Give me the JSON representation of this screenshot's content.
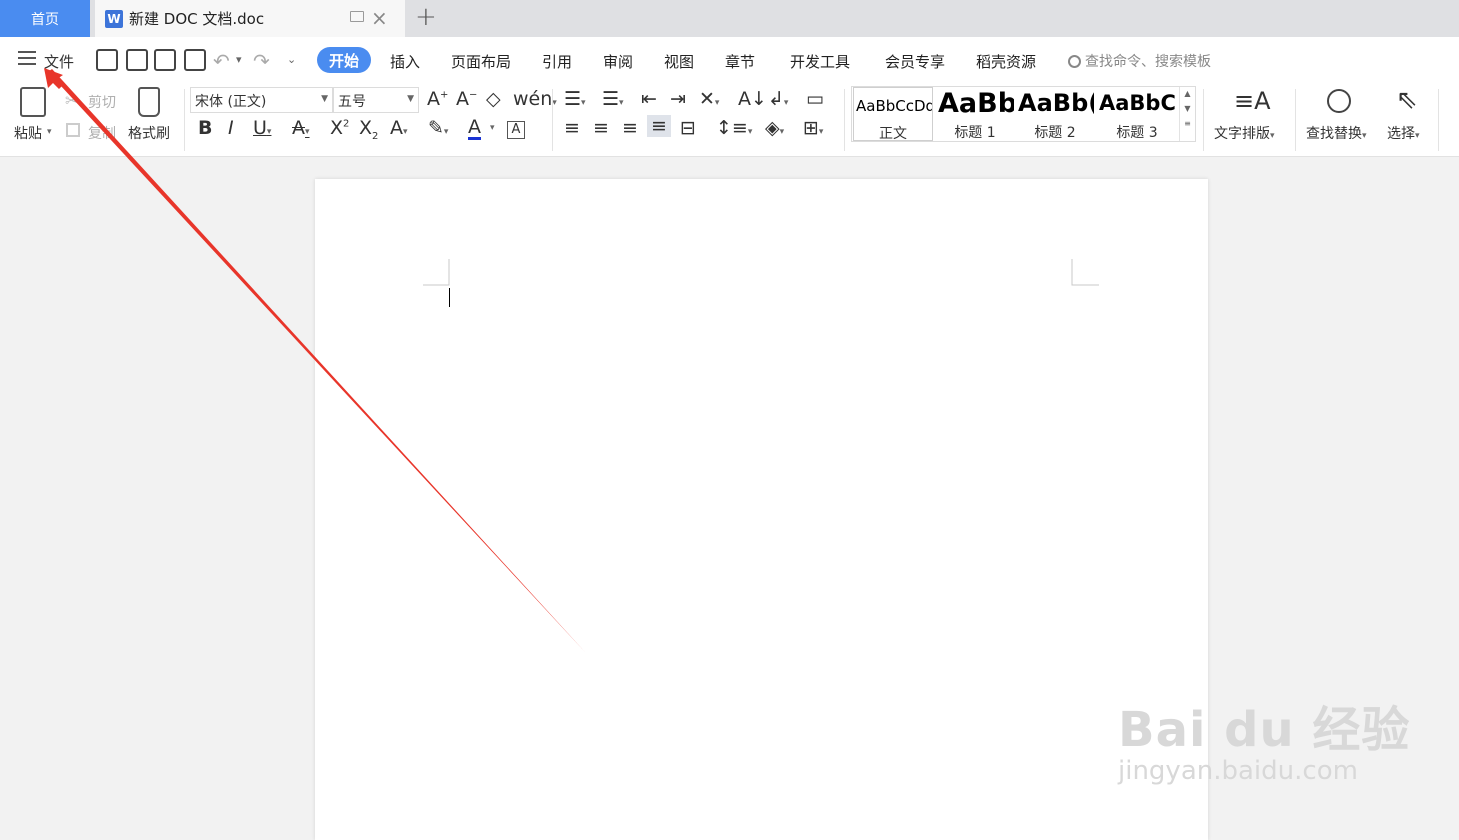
{
  "tabs": {
    "home": "首页",
    "document": "新建 DOC 文档.doc"
  },
  "menu": {
    "file": "文件",
    "tabs": [
      "开始",
      "插入",
      "页面布局",
      "引用",
      "审阅",
      "视图",
      "章节",
      "开发工具",
      "会员专享",
      "稻壳资源"
    ],
    "active_tab": "开始",
    "search_placeholder": "查找命令、搜索模板"
  },
  "ribbon": {
    "paste": "粘贴",
    "cut": "剪切",
    "copy": "复制",
    "format_painter": "格式刷",
    "font_name": "宋体 (正文)",
    "font_size": "五号",
    "styles": [
      {
        "preview": "AaBbCcDd",
        "name": "正文"
      },
      {
        "preview": "AaBb",
        "name": "标题 1"
      },
      {
        "preview": "AaBb(",
        "name": "标题 2"
      },
      {
        "preview": "AaBbC",
        "name": "标题 3"
      }
    ],
    "text_layout": "文字排版",
    "find_replace": "查找替换",
    "select": "选择"
  },
  "watermark": {
    "brand": "Bai du 经验",
    "url": "jingyan.baidu.com"
  },
  "colors": {
    "accent": "#4a8cf0",
    "annotation_arrow": "#e8352a"
  }
}
